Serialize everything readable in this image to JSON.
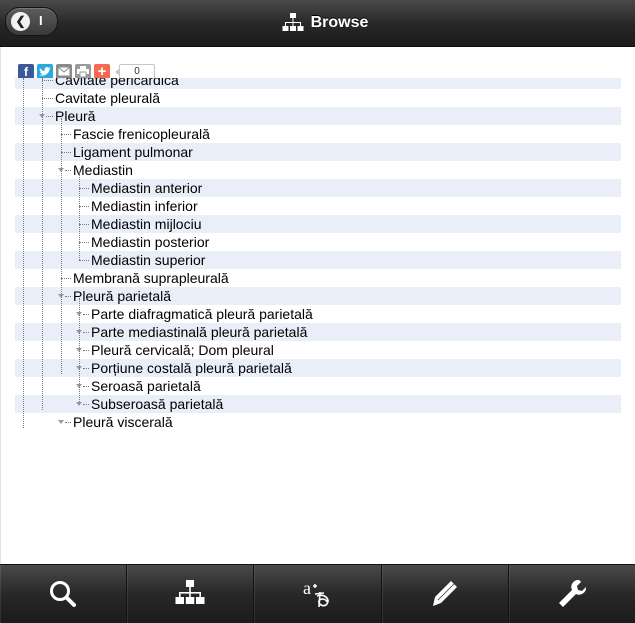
{
  "header": {
    "back_label": "I",
    "title": "Browse",
    "title_icon": "sitemap-icon"
  },
  "share_bar": {
    "buttons": [
      {
        "name": "facebook-icon",
        "color": "#3b5998"
      },
      {
        "name": "twitter-icon",
        "color": "#2aa9e0"
      },
      {
        "name": "email-icon",
        "color": "#8a8a8a"
      },
      {
        "name": "print-icon",
        "color": "#9a9a9a"
      },
      {
        "name": "plus-icon",
        "color": "#f8694d"
      }
    ],
    "count": "0"
  },
  "tree": {
    "items": [
      {
        "label": "Cavitate pericardică"
      },
      {
        "label": "Cavitate pleurală"
      },
      {
        "label": "Pleură"
      },
      {
        "label": "Fascie frenicopleurală"
      },
      {
        "label": "Ligament pulmonar"
      },
      {
        "label": "Mediastin"
      },
      {
        "label": "Mediastin anterior"
      },
      {
        "label": "Mediastin inferior"
      },
      {
        "label": "Mediastin mijlociu"
      },
      {
        "label": "Mediastin posterior"
      },
      {
        "label": "Mediastin superior"
      },
      {
        "label": "Membrană suprapleurală"
      },
      {
        "label": "Pleură parietală"
      },
      {
        "label": "Parte diafragmatică pleură parietală"
      },
      {
        "label": "Parte mediastinală pleură parietală"
      },
      {
        "label": "Pleură cervicală; Dom pleural"
      },
      {
        "label": "Porțiune costală pleură parietală"
      },
      {
        "label": "Seroasă parietală"
      },
      {
        "label": "Subseroasă parietală"
      },
      {
        "label": "Pleură viscerală"
      }
    ]
  },
  "toolbar": {
    "items": [
      {
        "name": "search-icon"
      },
      {
        "name": "sitemap-icon"
      },
      {
        "name": "translate-icon"
      },
      {
        "name": "pencil-icon"
      },
      {
        "name": "wrench-icon"
      }
    ]
  },
  "colors": {
    "row_highlight": "#e9eef9",
    "bar_dark": "#1c1c1c"
  }
}
